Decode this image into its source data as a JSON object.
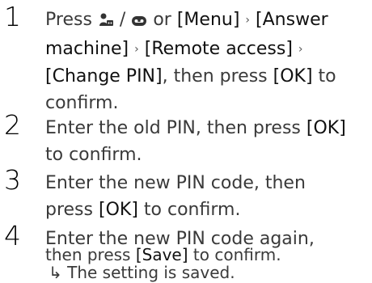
{
  "steps": [
    {
      "number": "1",
      "press": "Press",
      "slash": "/",
      "or_text": "or",
      "menu": "[Menu]",
      "answer_machine": "[Answer machine]",
      "remote_access": "[Remote access]",
      "change_pin": "[Change PIN]",
      "then_press": ", then press",
      "ok": "[OK]",
      "to_confirm": "to confirm."
    },
    {
      "number": "2",
      "line1": "Enter the old PIN, then press",
      "ok": "[OK]",
      "line2": "to confirm."
    },
    {
      "number": "3",
      "line1": "Enter the new PIN code, then",
      "press": "press",
      "ok": "[OK]",
      "line2": "to confirm."
    },
    {
      "number": "4",
      "line1": "Enter the new PIN code again,",
      "press": "then press",
      "save": "[Save]",
      "line2": "to confirm."
    }
  ],
  "result": {
    "arrow": "↳",
    "text": "The setting is saved."
  },
  "separator": "›",
  "icons": [
    "answer-machine-icon",
    "voicemail-icon"
  ]
}
